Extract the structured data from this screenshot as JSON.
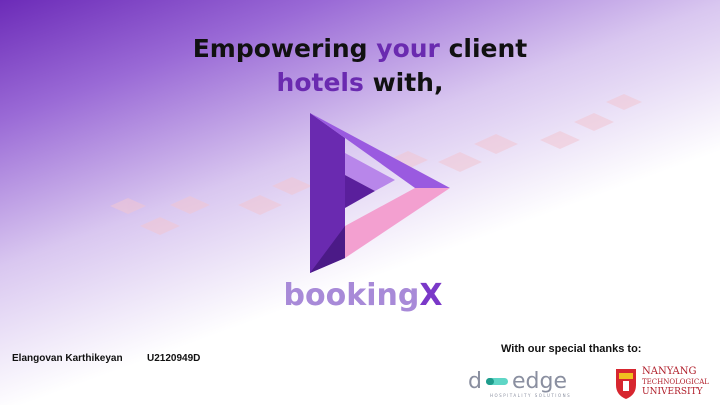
{
  "slide": {
    "title_line1_part1": "Empowering ",
    "title_line1_accent": "your",
    "title_line1_part2": " client",
    "title_line2_accent": "hotels",
    "title_line2_part2": " with,",
    "brand_main": "booking",
    "brand_x": "X",
    "author_name": "Elangovan Karthikeyan",
    "student_id": "U2120949D",
    "thanks_label": "With our special thanks to:",
    "dedge_logo_text": "d edge",
    "dedge_tagline": "HOSPITALITY SOLUTIONS",
    "ntu_name_line1": "NANYANG",
    "ntu_name_line2": "TECHNOLOGICAL",
    "ntu_name_line3": "UNIVERSITY"
  },
  "colors": {
    "accent_purple": "#6a2ab0",
    "brand_light": "#a88ad8",
    "logo_pink": "#f3a0d0",
    "ntu_red": "#b01e2a",
    "dedge_gray": "#8a8fa0"
  },
  "icons": [
    "bookingx-logo-icon",
    "dedge-logo-icon",
    "ntu-crest-icon"
  ]
}
